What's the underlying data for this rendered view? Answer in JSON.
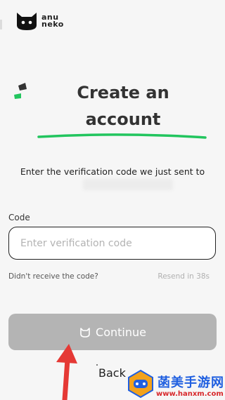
{
  "brand": {
    "name_line1": "anu",
    "name_line2": "neko"
  },
  "heading": {
    "line1": "Create an",
    "line2": "account"
  },
  "verify": {
    "message": "Enter the verification code we just sent to"
  },
  "code": {
    "label": "Code",
    "placeholder": "Enter verification code"
  },
  "resend": {
    "question": "Didn't receive the code?",
    "timer": "Resend in 38s"
  },
  "actions": {
    "continue_label": "Continue",
    "back_label": "Back"
  },
  "watermark": {
    "text": "菡美手游网",
    "url": "www.hanxm.com"
  },
  "colors": {
    "accent_green": "#22c55e",
    "button_disabled": "#b4b4b4",
    "arrow_red": "#e53935"
  }
}
